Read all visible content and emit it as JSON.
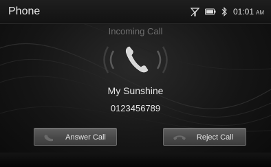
{
  "app": {
    "title": "Phone"
  },
  "status_bar": {
    "icons": [
      "signal-off-icon",
      "battery-icon",
      "bluetooth-icon"
    ],
    "time": "01:01",
    "ampm": "AM"
  },
  "call": {
    "status": "Incoming Call",
    "caller_name": "My Sunshine",
    "caller_number": "0123456789",
    "icon": "phone-ringing-icon"
  },
  "actions": {
    "answer_label": "Answer Call",
    "answer_icon": "phone-answer-icon",
    "reject_label": "Reject Call",
    "reject_icon": "phone-hangup-icon"
  },
  "colors": {
    "background": "#151515",
    "button": "#4a4a4a",
    "text": "#e6e6e6",
    "status_text": "#6e6e6e"
  }
}
